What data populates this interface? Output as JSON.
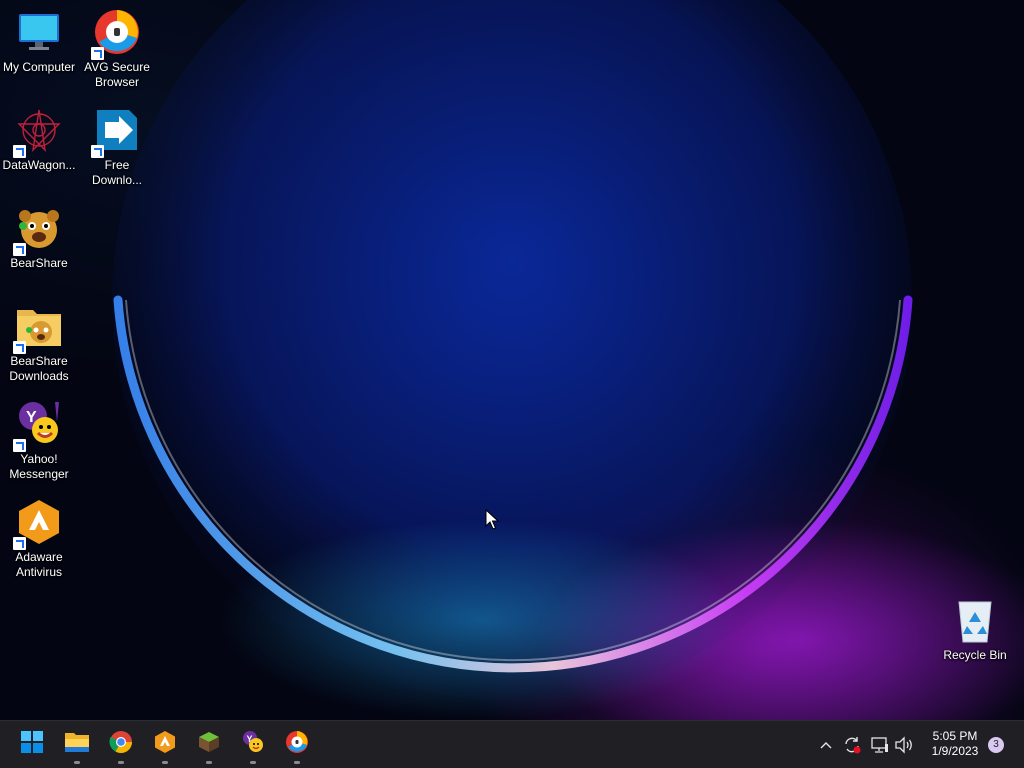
{
  "desktop": {
    "icons": [
      {
        "id": "my-computer",
        "label": "My Computer"
      },
      {
        "id": "avg",
        "label": "AVG Secure Browser"
      },
      {
        "id": "datawagon",
        "label": "DataWagon..."
      },
      {
        "id": "free-download",
        "label": "Free Downlo..."
      },
      {
        "id": "bearshare",
        "label": "BearShare"
      },
      {
        "id": "bearshare-downloads",
        "label": "BearShare Downloads"
      },
      {
        "id": "yahoo",
        "label": "Yahoo! Messenger"
      },
      {
        "id": "adaware",
        "label": "Adaware Antivirus"
      },
      {
        "id": "recycle-bin",
        "label": "Recycle Bin"
      }
    ]
  },
  "taskbar": {
    "pinned": [
      "start-icon",
      "file-explorer-icon",
      "chrome-icon",
      "adaware-icon",
      "minecraft-icon",
      "yahoo-messenger-icon",
      "avg-browser-icon"
    ],
    "clock": {
      "time": "5:05 PM",
      "date": "1/9/2023"
    },
    "notification_count": "3"
  },
  "colors": {
    "taskbar": "#1f1f24",
    "accent": "#0078d4"
  }
}
